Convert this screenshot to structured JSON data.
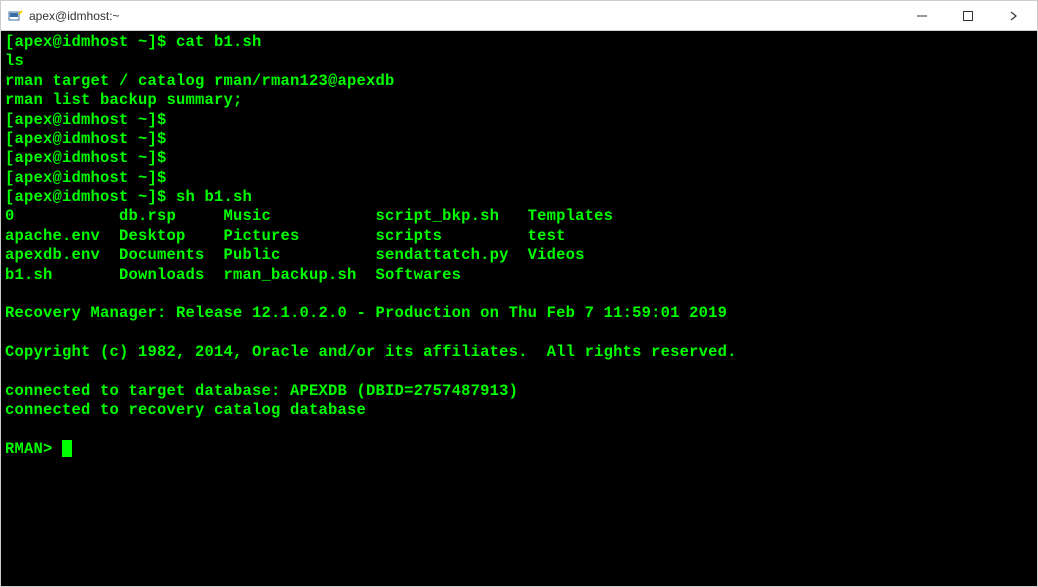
{
  "window": {
    "title": "apex@idmhost:~"
  },
  "terminal": {
    "lines": [
      {
        "prompt": "[apex@idmhost ~]$ ",
        "cmd": "cat b1.sh"
      },
      {
        "output": "ls"
      },
      {
        "output": "rman target / catalog rman/rman123@apexdb"
      },
      {
        "output": "rman list backup summary;"
      },
      {
        "prompt": "[apex@idmhost ~]$ ",
        "cmd": ""
      },
      {
        "prompt": "[apex@idmhost ~]$ ",
        "cmd": ""
      },
      {
        "prompt": "[apex@idmhost ~]$ ",
        "cmd": ""
      },
      {
        "prompt": "[apex@idmhost ~]$ ",
        "cmd": ""
      },
      {
        "prompt": "[apex@idmhost ~]$ ",
        "cmd": "sh b1.sh"
      },
      {
        "output": "0           db.rsp     Music           script_bkp.sh   Templates"
      },
      {
        "output": "apache.env  Desktop    Pictures        scripts         test"
      },
      {
        "output": "apexdb.env  Documents  Public          sendattatch.py  Videos"
      },
      {
        "output": "b1.sh       Downloads  rman_backup.sh  Softwares"
      },
      {
        "output": ""
      },
      {
        "output": "Recovery Manager: Release 12.1.0.2.0 - Production on Thu Feb 7 11:59:01 2019"
      },
      {
        "output": ""
      },
      {
        "output": "Copyright (c) 1982, 2014, Oracle and/or its affiliates.  All rights reserved."
      },
      {
        "output": ""
      },
      {
        "output": "connected to target database: APEXDB (DBID=2757487913)"
      },
      {
        "output": "connected to recovery catalog database"
      },
      {
        "output": ""
      },
      {
        "output": "RMAN> ",
        "cursor": true
      }
    ]
  }
}
